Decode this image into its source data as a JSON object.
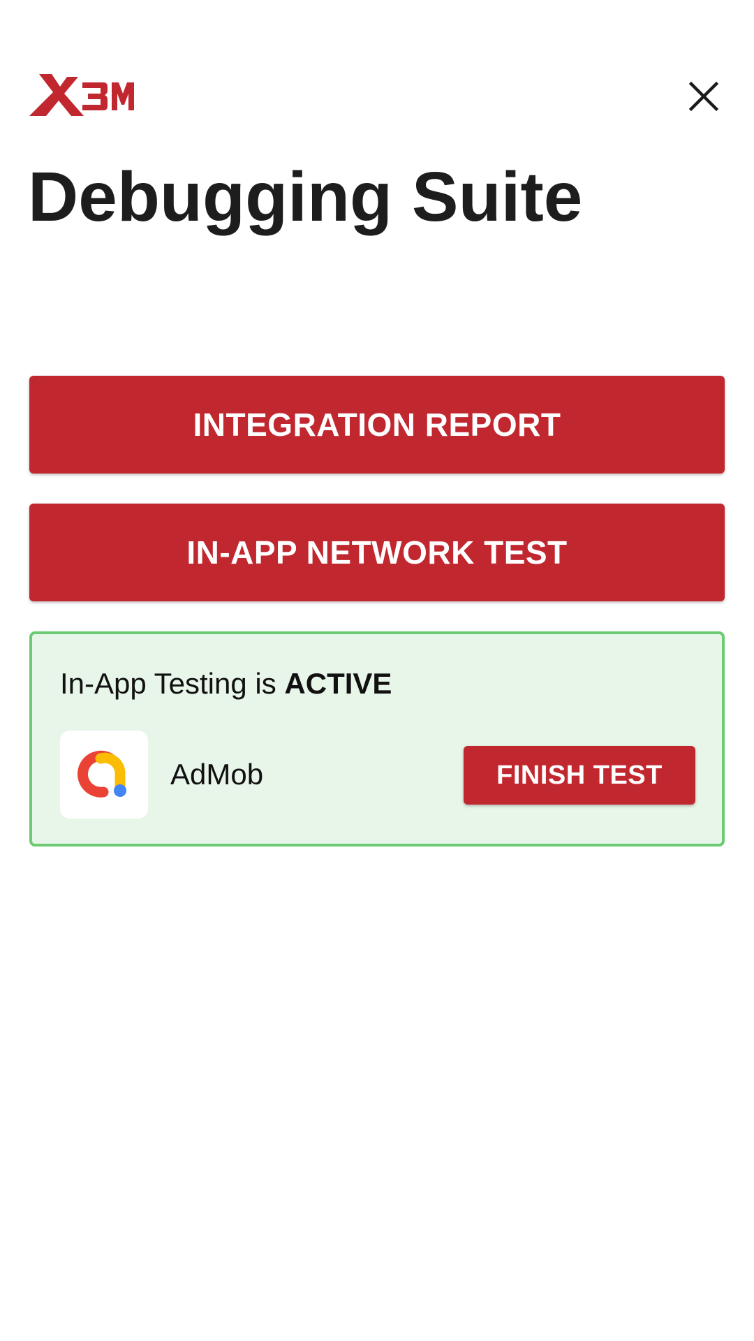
{
  "header": {
    "logo_text": "X3M",
    "logo_icon": "x3m-logo",
    "close_icon": "close-icon"
  },
  "page": {
    "title": "Debugging Suite"
  },
  "actions": {
    "integration_report_label": "INTEGRATION REPORT",
    "network_test_label": "IN-APP NETWORK TEST"
  },
  "status_card": {
    "prefix": "In-App Testing is ",
    "state": "ACTIVE",
    "network": {
      "name": "AdMob",
      "icon": "admob-icon"
    },
    "finish_label": "FINISH TEST"
  },
  "colors": {
    "brand_red": "#c1272f",
    "active_border": "#6ccb72",
    "active_background": "#e8f5e9",
    "text_dark": "#1d1d1d"
  }
}
